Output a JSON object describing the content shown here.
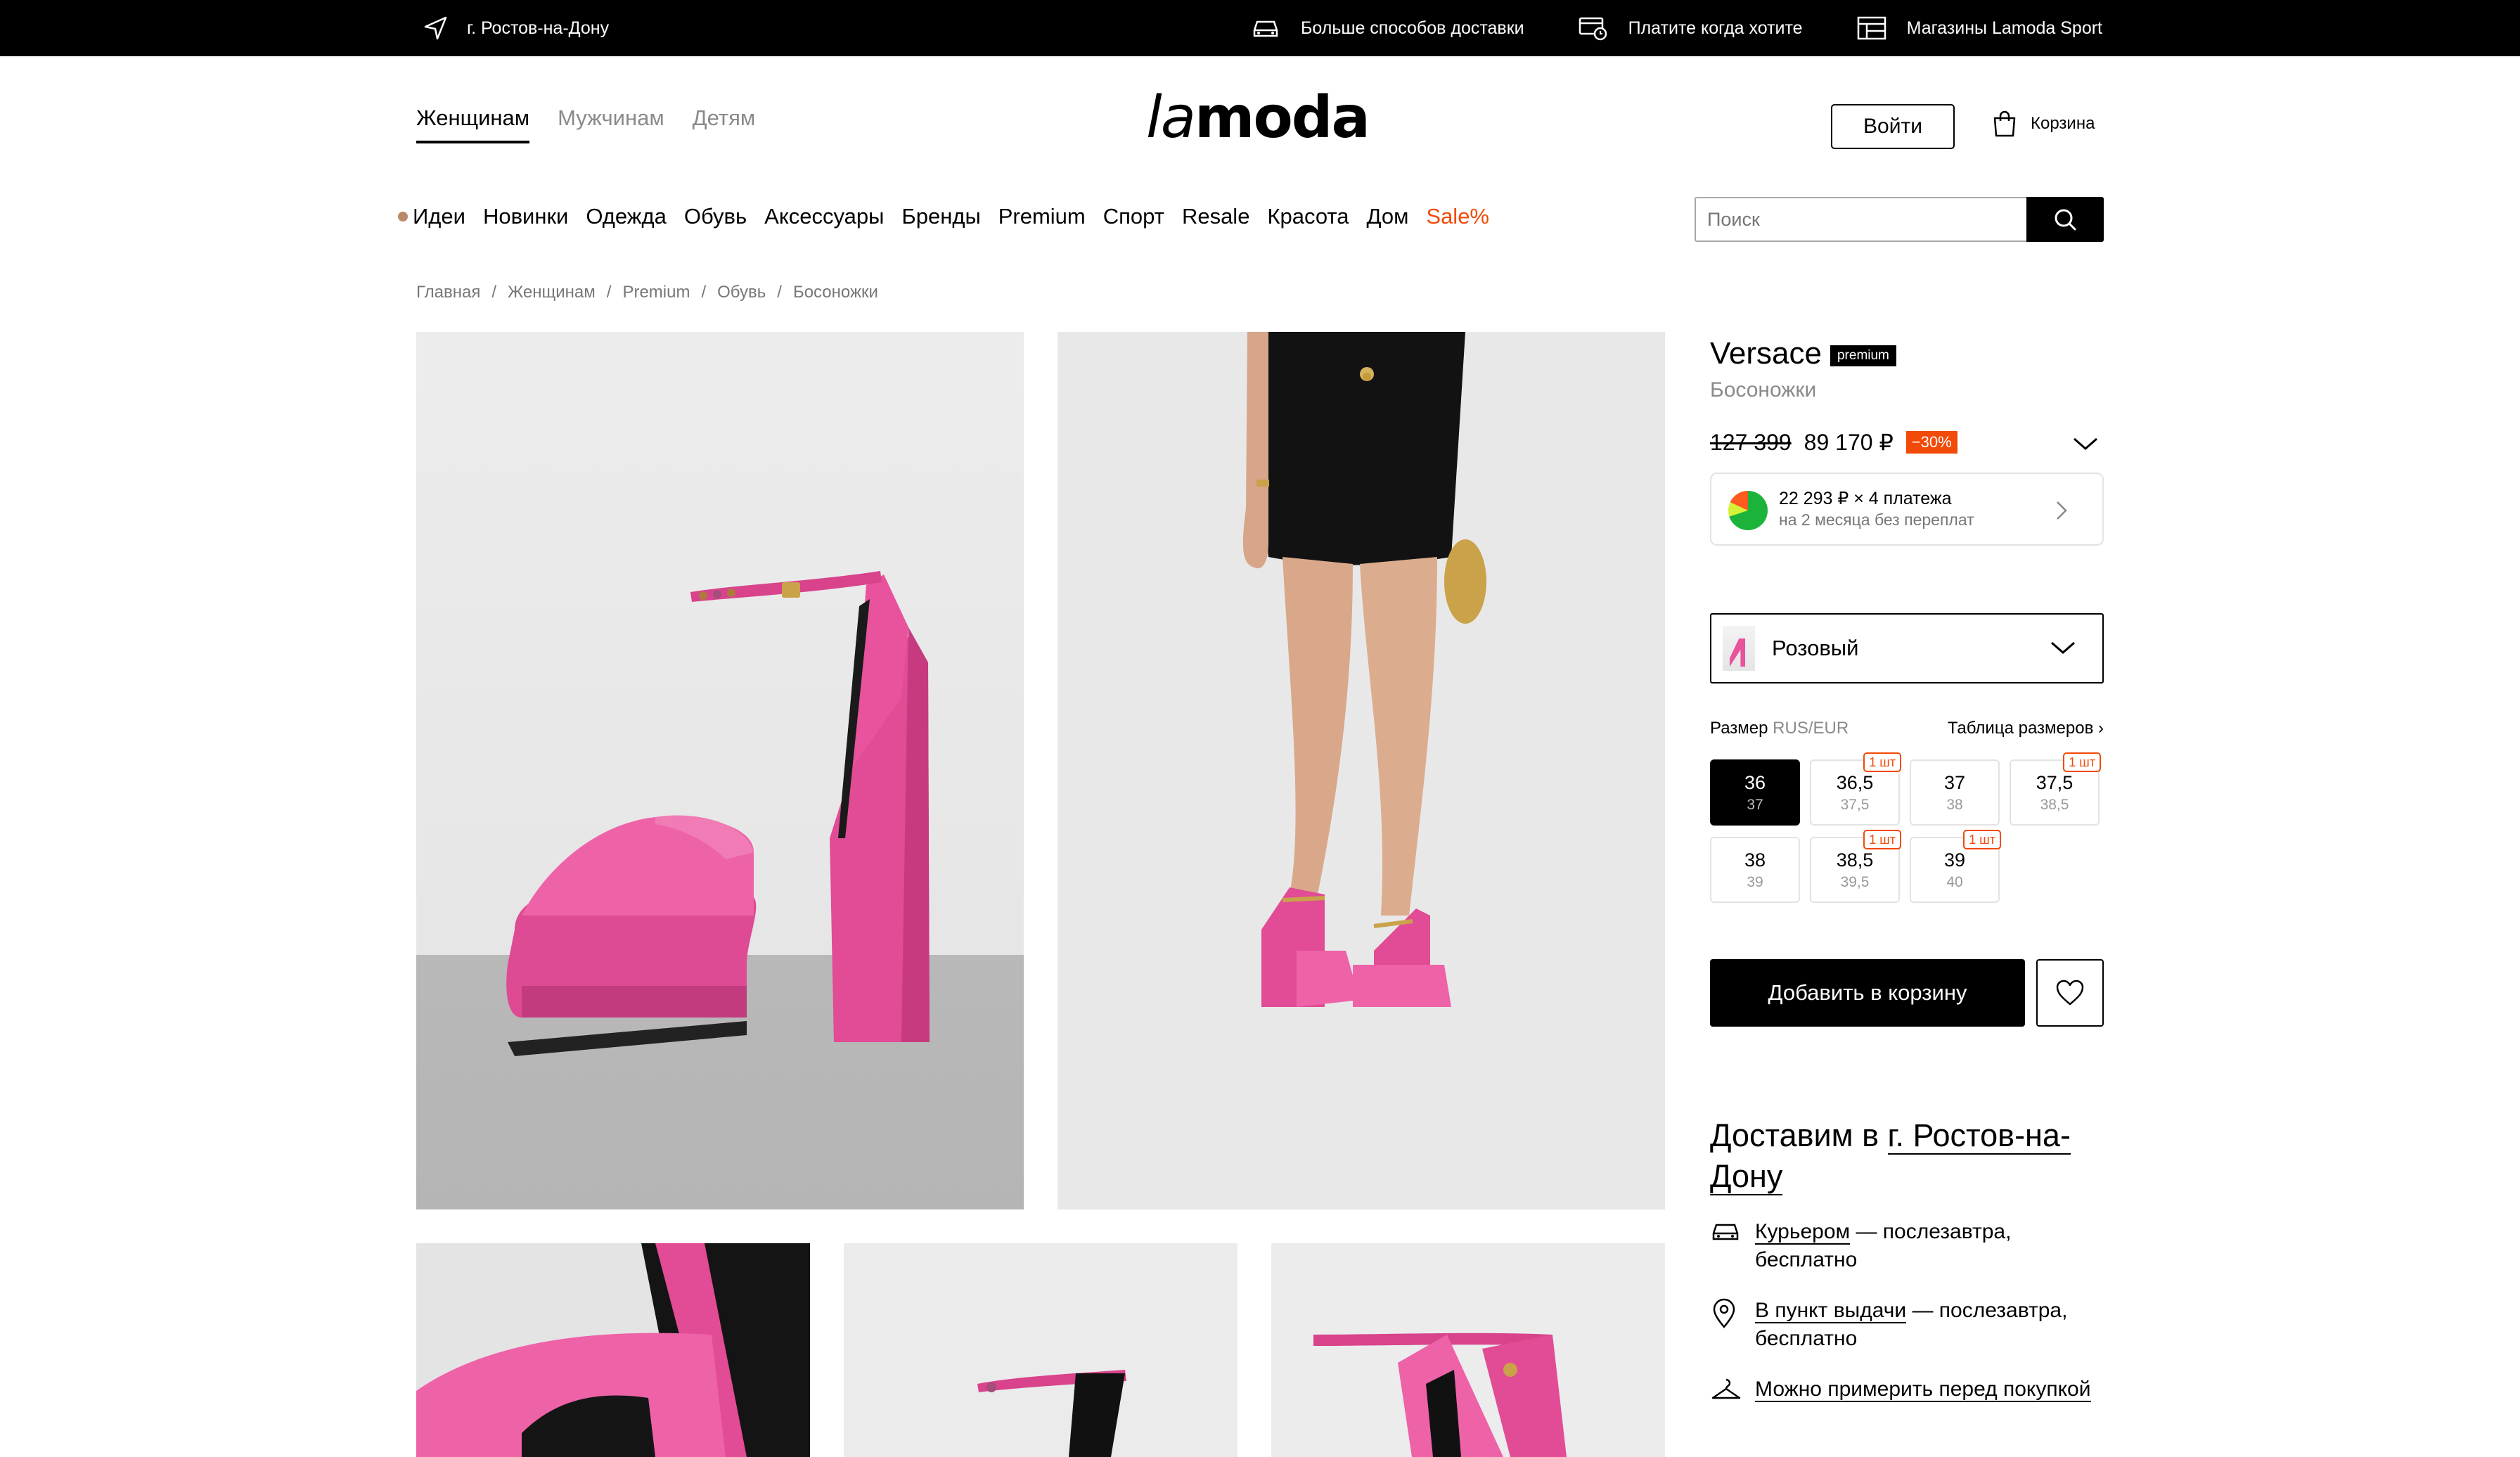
{
  "topbar": {
    "city": "г. Ростов-на-Дону",
    "delivery": "Больше способов доставки",
    "pay": "Платите когда хотите",
    "stores": "Магазины Lamoda Sport"
  },
  "header": {
    "gender_tabs": [
      "Женщинам",
      "Мужчинам",
      "Детям"
    ],
    "logo": {
      "prefix": "la",
      "suffix": "moda"
    },
    "login": "Войти",
    "cart": "Корзина"
  },
  "nav": {
    "items": [
      "Идеи",
      "Новинки",
      "Одежда",
      "Обувь",
      "Аксессуары",
      "Бренды",
      "Premium",
      "Спорт",
      "Resale",
      "Красота",
      "Дом",
      "Sale%"
    ],
    "search_placeholder": "Поиск"
  },
  "breadcrumb": [
    "Главная",
    "Женщинам",
    "Premium",
    "Обувь",
    "Босоножки"
  ],
  "product": {
    "brand": "Versace",
    "badge": "premium",
    "type": "Босоножки",
    "old_price": "127 399",
    "price": "89 170 ₽",
    "discount": "−30%",
    "installment": {
      "line1": "22 293 ₽ × 4 платежа",
      "line2": "на 2 месяца без переплат"
    },
    "color": "Розовый",
    "size_label": "Размер",
    "size_system": "RUS/EUR",
    "size_table": "Таблица размеров",
    "sizes": [
      {
        "rus": "36",
        "eur": "37",
        "tag": ""
      },
      {
        "rus": "36,5",
        "eur": "37,5",
        "tag": "1 шт"
      },
      {
        "rus": "37",
        "eur": "38",
        "tag": ""
      },
      {
        "rus": "37,5",
        "eur": "38,5",
        "tag": "1 шт"
      },
      {
        "rus": "38",
        "eur": "39",
        "tag": ""
      },
      {
        "rus": "38,5",
        "eur": "39,5",
        "tag": "1 шт"
      },
      {
        "rus": "39",
        "eur": "40",
        "tag": "1 шт"
      }
    ],
    "add_to_cart": "Добавить в корзину"
  },
  "delivery": {
    "heading": "Доставим в",
    "city": "г. Ростов-на-Дону",
    "courier_link": "Курьером",
    "courier_text": " — послезавтра, бесплатно",
    "pickup_link": "В пункт выдачи",
    "pickup_text": " — послезавтра, бесплатно",
    "tryon": "Можно примерить перед покупкой"
  },
  "colors": {
    "accent": "#f24a08",
    "shoe_pink": "#e9529c"
  }
}
